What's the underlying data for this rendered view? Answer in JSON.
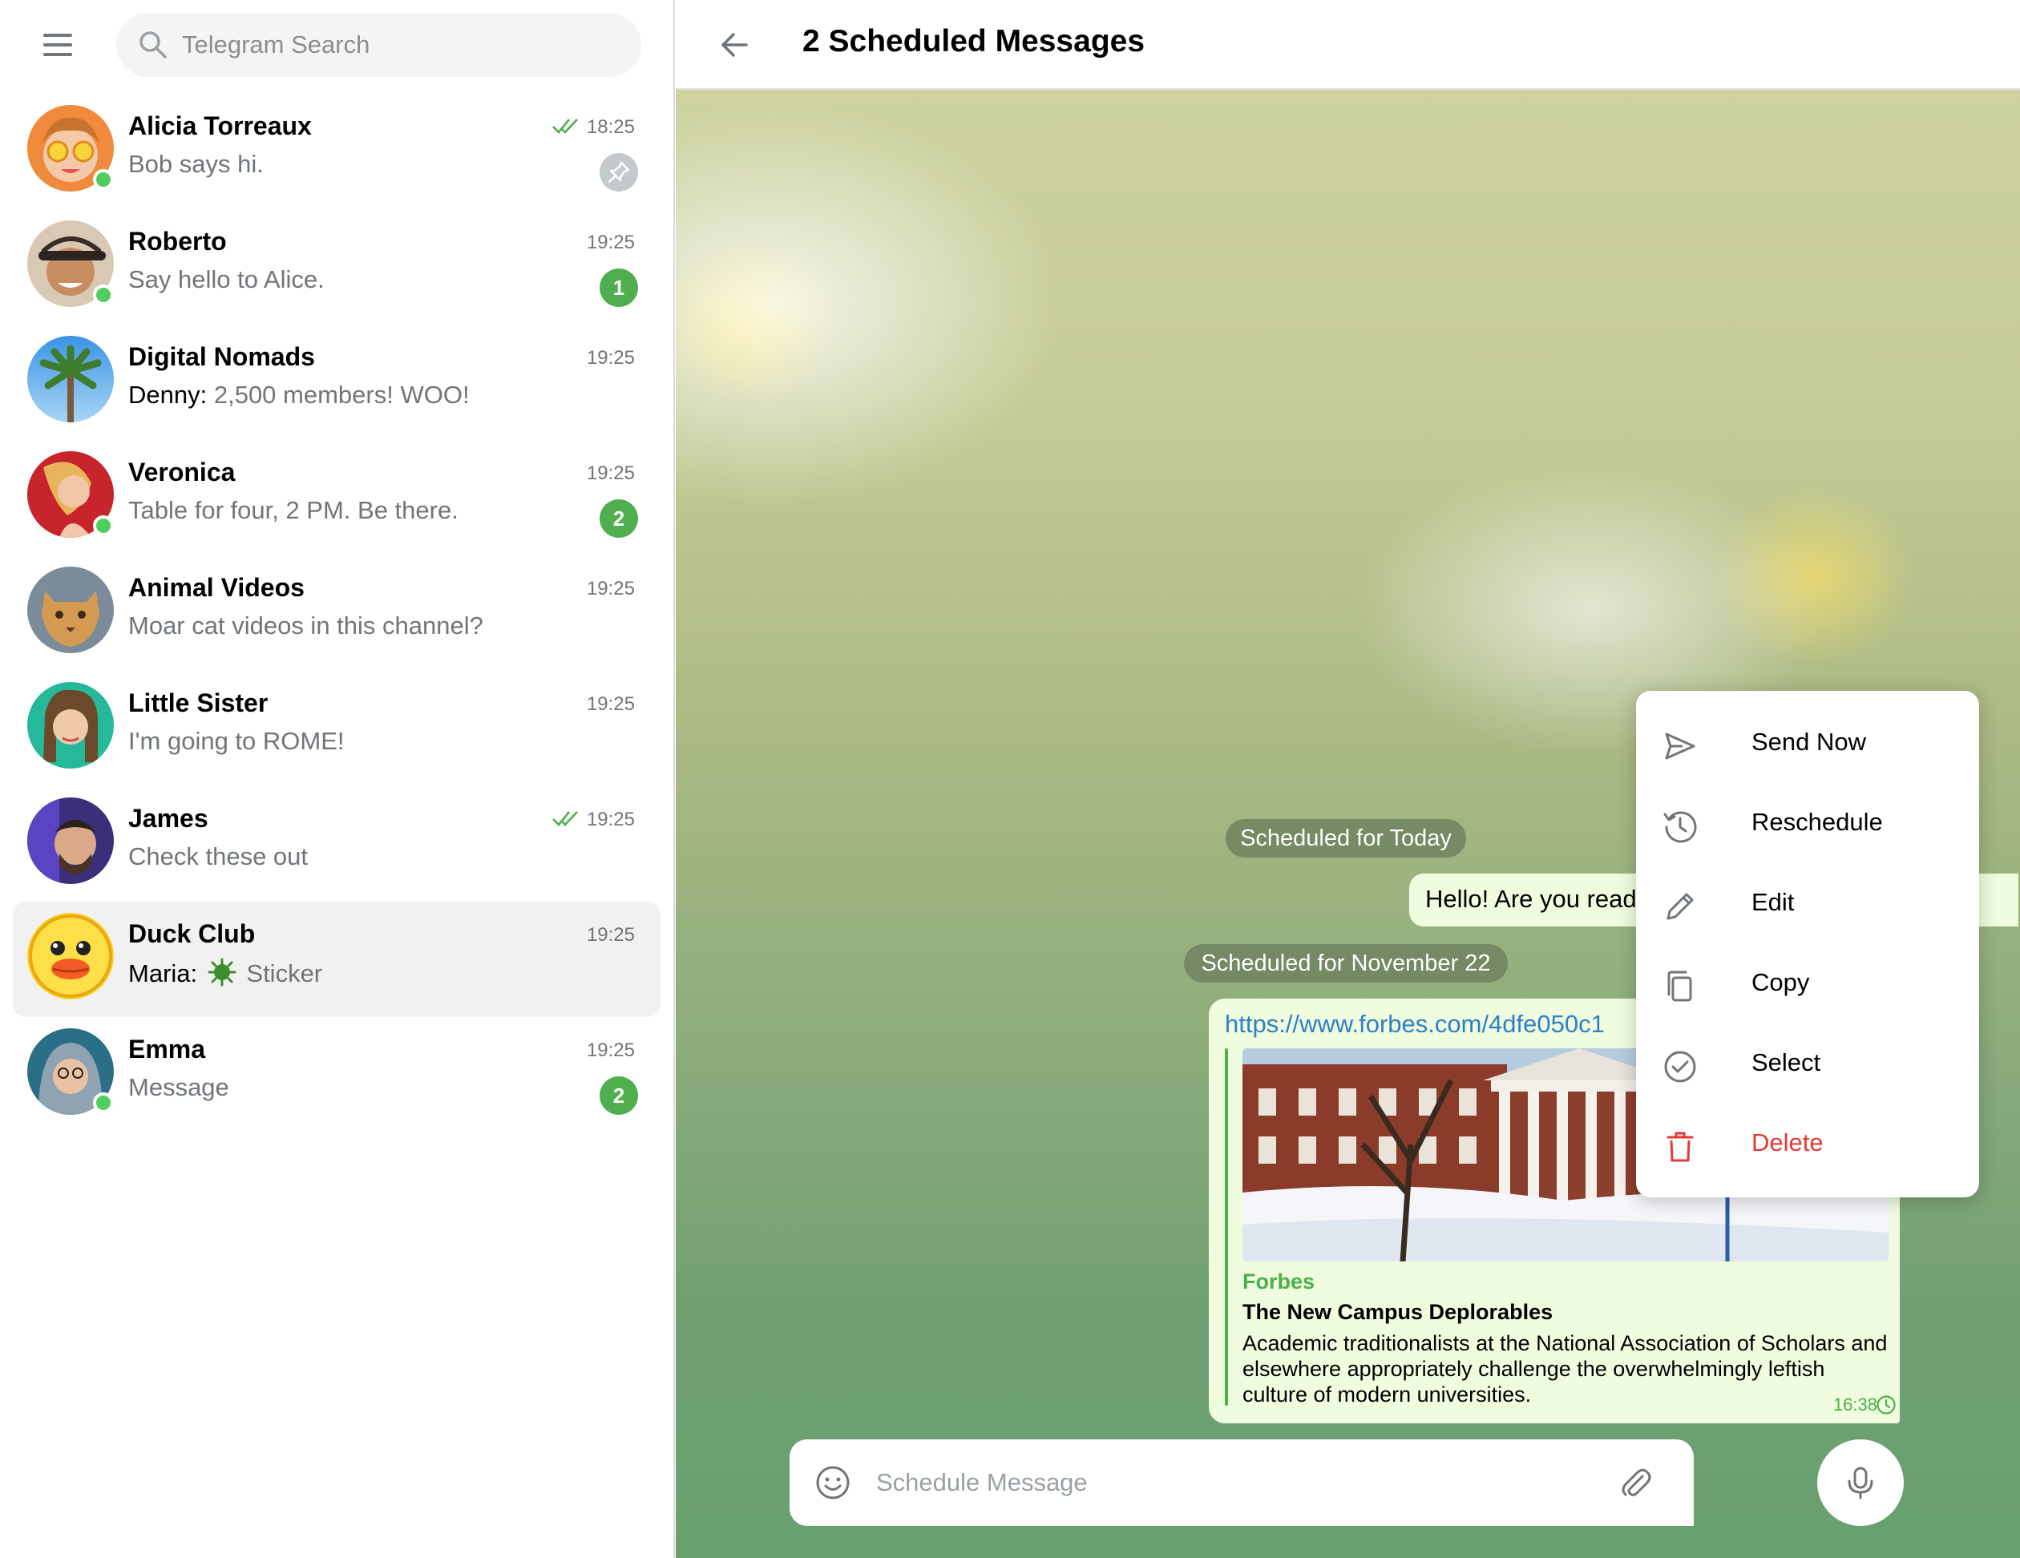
{
  "search": {
    "placeholder": "Telegram Search"
  },
  "chats": [
    {
      "name": "Alicia Torreaux",
      "message": "Bob says hi.",
      "time": "18:25",
      "online": true,
      "read": true,
      "pinned": true
    },
    {
      "name": "Roberto",
      "message": "Say hello to Alice.",
      "time": "19:25",
      "online": true,
      "badge": "1"
    },
    {
      "name": "Digital Nomads",
      "sender": "Denny:",
      "message": " 2,500 members! WOO!",
      "time": "19:25"
    },
    {
      "name": "Veronica",
      "message": "Table for four, 2 PM. Be there.",
      "time": "19:25",
      "online": true,
      "badge": "2"
    },
    {
      "name": "Animal Videos",
      "message": "Moar cat videos in this channel?",
      "time": "19:25"
    },
    {
      "name": "Little Sister",
      "message": "I'm going to ROME!",
      "time": "19:25"
    },
    {
      "name": "James",
      "message": "Check these out",
      "time": "19:25",
      "read": true
    },
    {
      "name": "Duck Club",
      "sender": "Maria:",
      "message": "Sticker",
      "time": "19:25",
      "active": true
    },
    {
      "name": "Emma",
      "message": "Message",
      "time": "19:25",
      "online": true,
      "badge": "2"
    }
  ],
  "header": {
    "title": "2 Scheduled Messages"
  },
  "messages": {
    "pill_today": "Scheduled for Today",
    "msg1_text": "Hello! Are you read",
    "pill_nov": "Scheduled for November 22",
    "msg2_link": "https://www.forbes.com/4dfe050c1",
    "preview_site": "Forbes",
    "preview_title": "The New Campus Deplorables",
    "preview_desc": "Academic traditionalists at the National Association of Scholars and elsewhere appropriately challenge the overwhelmingly leftish culture of modern universities.",
    "msg2_time": "16:38"
  },
  "context_menu": {
    "send_now": "Send Now",
    "reschedule": "Reschedule",
    "edit": "Edit",
    "copy": "Copy",
    "select": "Select",
    "delete": "Delete"
  },
  "composer": {
    "placeholder": "Schedule Message"
  },
  "colors": {
    "accent_green": "#4fae4e",
    "online_green": "#4fce5d",
    "link_blue": "#2f7fc7",
    "danger_red": "#e53935",
    "bubble_out": "#effdde"
  }
}
